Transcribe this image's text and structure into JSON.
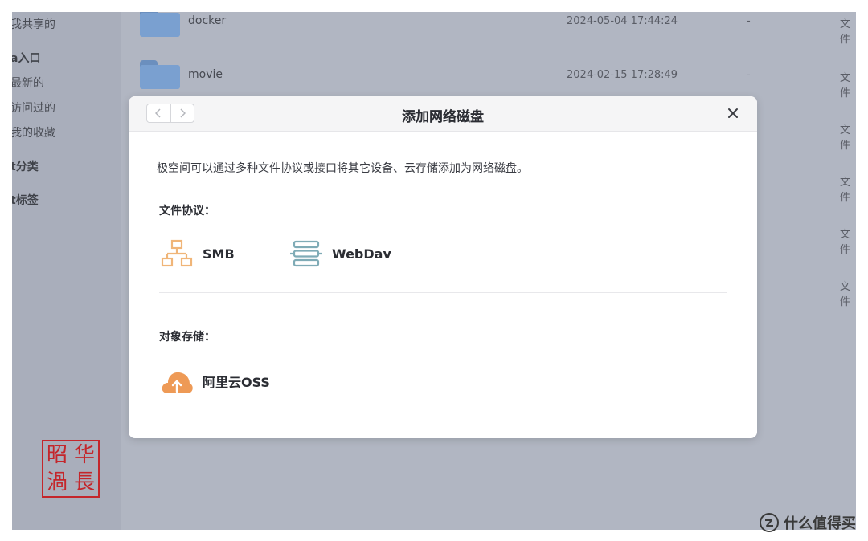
{
  "sidebar": {
    "items": [
      {
        "label": "我共享的",
        "section": false
      },
      {
        "label": "a入口",
        "section": true
      },
      {
        "label": "最新的",
        "section": false
      },
      {
        "label": "访问过的",
        "section": false
      },
      {
        "label": "我的收藏",
        "section": false
      },
      {
        "label": "t分类",
        "section": true
      },
      {
        "label": "t标签",
        "section": true
      }
    ]
  },
  "files": [
    {
      "name": "docker",
      "date": "2024-05-04 17:44:24",
      "size": "-",
      "type": "文件"
    },
    {
      "name": "movie",
      "date": "2024-02-15 17:28:49",
      "size": "-",
      "type": "文件"
    },
    {
      "name": "",
      "date": "",
      "size": "",
      "type": "文件"
    },
    {
      "name": "",
      "date": "",
      "size": "",
      "type": "文件"
    },
    {
      "name": "",
      "date": "",
      "size": "",
      "type": "文件"
    },
    {
      "name": "",
      "date": "",
      "size": "",
      "type": "文件"
    }
  ],
  "stamp": {
    "chars": [
      "昭",
      "华",
      "渦",
      "長"
    ]
  },
  "dialog": {
    "title": "添加网络磁盘",
    "back_icon": "chevron-left-icon",
    "forward_icon": "chevron-right-icon",
    "close_icon": "close-icon",
    "description": "极空间可以通过多种文件协议或接口将其它设备、云存储添加为网络磁盘。",
    "file_protocols": {
      "title": "文件协议：",
      "options": [
        {
          "label": "SMB",
          "icon": "network-tree-icon",
          "color": "#f0b578"
        },
        {
          "label": "WebDav",
          "icon": "server-stack-icon",
          "color": "#7fabb6"
        }
      ]
    },
    "object_storage": {
      "title": "对象存储：",
      "options": [
        {
          "label": "阿里云OSS",
          "icon": "cloud-upload-icon",
          "color": "#ee9a56"
        }
      ]
    }
  },
  "watermark": {
    "text": "什么值得买",
    "icon": "smzdm-logo-icon"
  }
}
